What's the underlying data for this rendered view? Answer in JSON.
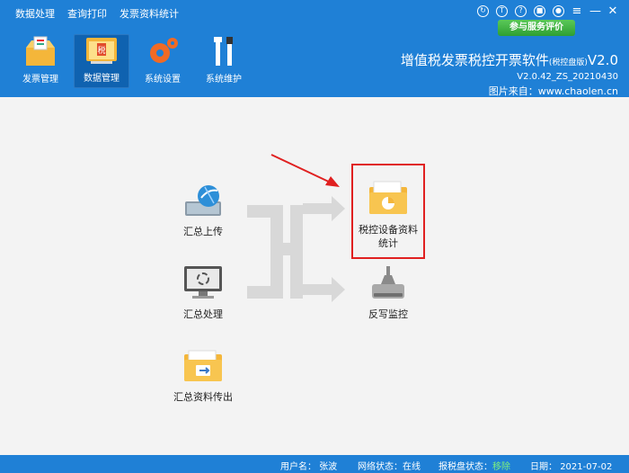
{
  "menu": [
    "数据处理",
    "查询打印",
    "发票资料统计"
  ],
  "window_icons": [
    "refresh-icon",
    "shirt-icon",
    "help-icon",
    "lock-icon",
    "user-icon",
    "menu-icon",
    "minimize-icon",
    "close-icon"
  ],
  "rate_button": "参与服务评价",
  "toolbar": [
    {
      "label": "发票管理",
      "icon": "invoice-box-icon",
      "active": false
    },
    {
      "label": "数据管理",
      "icon": "data-folder-icon",
      "active": true
    },
    {
      "label": "系统设置",
      "icon": "gear-icon",
      "active": false
    },
    {
      "label": "系统维护",
      "icon": "tools-icon",
      "active": false
    }
  ],
  "brand": {
    "title": "增值税发票税控开票软件",
    "edition": "(税控盘版)",
    "version": "V2.0",
    "build": "V2.0.42_ZS_20210430",
    "source": "图片来自：www.chaolen.cn"
  },
  "items": {
    "upload": "汇总上传",
    "process": "汇总处理",
    "export": "汇总资料传出",
    "stats": "税控设备资料统计",
    "writeback": "反写监控"
  },
  "status": {
    "user_label": "用户名：",
    "user": "张波",
    "net_label": "网络状态：",
    "net": "在线",
    "disk_label": "报税盘状态：",
    "disk": "移除",
    "date_label": "日期：",
    "date": "2021-07-02"
  },
  "colors": {
    "header": "#1f80d6",
    "highlight": "#e02020",
    "arrow": "#e02020"
  }
}
